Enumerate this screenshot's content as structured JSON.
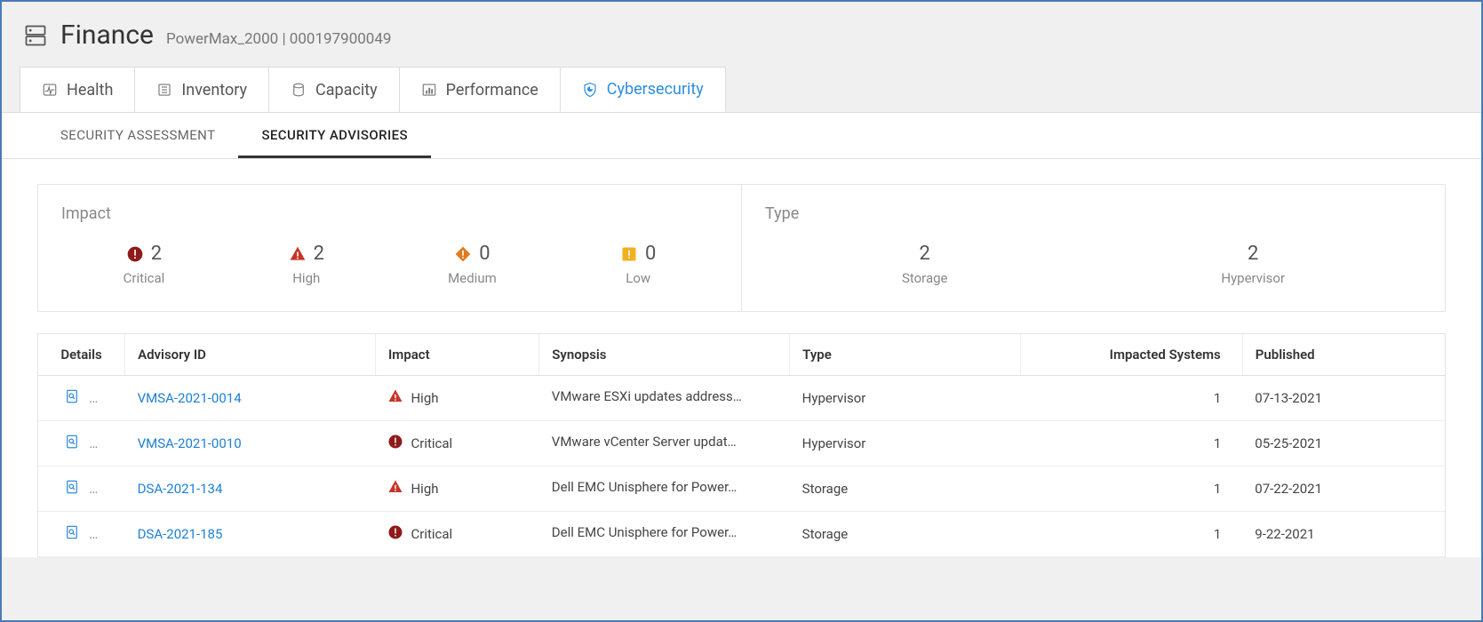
{
  "header": {
    "title": "Finance",
    "subtitle": "PowerMax_2000 | 000197900049"
  },
  "primary_tabs": [
    {
      "label": "Health"
    },
    {
      "label": "Inventory"
    },
    {
      "label": "Capacity"
    },
    {
      "label": "Performance"
    },
    {
      "label": "Cybersecurity"
    }
  ],
  "secondary_tabs": [
    {
      "label": "SECURITY ASSESSMENT"
    },
    {
      "label": "SECURITY ADVISORIES"
    }
  ],
  "summary": {
    "impact": {
      "title": "Impact",
      "critical": {
        "count": "2",
        "label": "Critical"
      },
      "high": {
        "count": "2",
        "label": "High"
      },
      "medium": {
        "count": "0",
        "label": "Medium"
      },
      "low": {
        "count": "0",
        "label": "Low"
      }
    },
    "type": {
      "title": "Type",
      "storage": {
        "count": "2",
        "label": "Storage"
      },
      "hypervisor": {
        "count": "2",
        "label": "Hypervisor"
      }
    }
  },
  "table": {
    "columns": {
      "details": "Details",
      "advisory_id": "Advisory ID",
      "impact": "Impact",
      "synopsis": "Synopsis",
      "type": "Type",
      "impacted_systems": "Impacted Systems",
      "published": "Published"
    },
    "rows": [
      {
        "advisory_id": "VMSA-2021-0014",
        "impact": "High",
        "impact_level": "high",
        "synopsis": "VMware ESXi updates address…",
        "type": "Hypervisor",
        "impacted_systems": "1",
        "published": "07-13-2021"
      },
      {
        "advisory_id": "VMSA-2021-0010",
        "impact": "Critical",
        "impact_level": "critical",
        "synopsis": "VMware vCenter Server updat…",
        "type": "Hypervisor",
        "impacted_systems": "1",
        "published": "05-25-2021"
      },
      {
        "advisory_id": "DSA-2021-134",
        "impact": "High",
        "impact_level": "high",
        "synopsis": "Dell EMC Unisphere for Power…",
        "type": "Storage",
        "impacted_systems": "1",
        "published": "07-22-2021"
      },
      {
        "advisory_id": "DSA-2021-185",
        "impact": "Critical",
        "impact_level": "critical",
        "synopsis": "Dell EMC Unisphere for Power…",
        "type": "Storage",
        "impacted_systems": "1",
        "published": "9-22-2021"
      }
    ]
  }
}
